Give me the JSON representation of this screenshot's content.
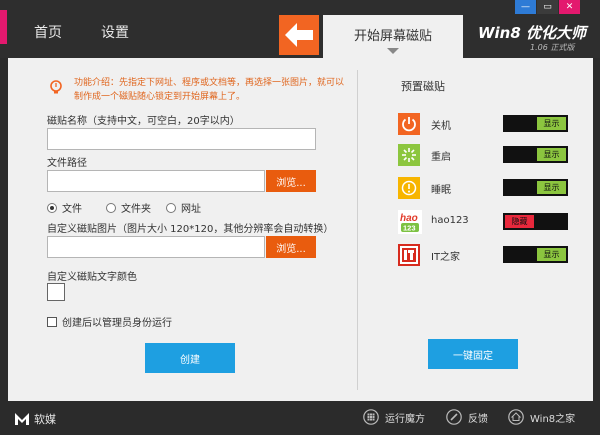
{
  "nav": {
    "home": "首页",
    "settings": "设置"
  },
  "tab_title": "开始屏幕磁贴",
  "brand": {
    "name": "Win8 优化大师",
    "version": "1.06 正式版"
  },
  "window_controls": [
    {
      "glyph": "—",
      "color": "#2e7bd6"
    },
    {
      "glyph": "▭",
      "color": "#3b3b3b"
    },
    {
      "glyph": "✕",
      "color": "#e3196e"
    }
  ],
  "info": {
    "text": "功能介绍：先指定下网址、程序或文档等，再选择一张图片，就可以制作成一个磁贴随心锁定到开始屏幕上了。"
  },
  "form": {
    "tile_name_label": "磁贴名称（支持中文，可空白，20字以内）",
    "tile_name_value": "",
    "file_path_label": "文件路径",
    "file_path_value": "",
    "browse_label": "浏览...",
    "radio_options": [
      "文件",
      "文件夹",
      "网址"
    ],
    "selected_radio": 0,
    "image_label": "自定义磁贴图片（图片大小 120*120，其他分辨率会自动转换）",
    "image_value": "",
    "text_color_label": "自定义磁贴文字颜色",
    "admin_label": "创建后以管理员身份运行",
    "create_label": "创建"
  },
  "presets": {
    "title": "预置磁贴",
    "items": [
      {
        "label": "关机",
        "status": "显示",
        "on": true,
        "color": "#f26522"
      },
      {
        "label": "重启",
        "status": "显示",
        "on": true,
        "color": "#8cc63f"
      },
      {
        "label": "睡眠",
        "status": "显示",
        "on": true,
        "color": "#f7b500"
      },
      {
        "label": "hao123",
        "status": "隐藏",
        "on": false,
        "color": "#7dc242"
      },
      {
        "label": "IT之家",
        "status": "显示",
        "on": true,
        "color": "#d72b1e"
      }
    ],
    "fix_label": "一键固定"
  },
  "footer": {
    "logo": "软媒",
    "items": [
      "运行魔方",
      "反馈",
      "Win8之家"
    ]
  },
  "colors": {
    "accent_orange": "#e95c0e",
    "accent_blue": "#1e9fe1",
    "toggle_on": "#8cc63f",
    "toggle_off": "#e8283c",
    "pink": "#e3196e"
  }
}
